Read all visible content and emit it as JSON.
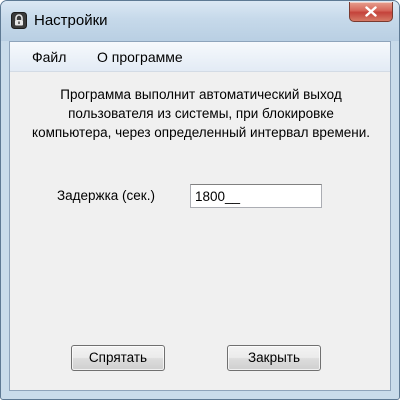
{
  "window": {
    "title": "Настройки",
    "close_label": "✕"
  },
  "menu": {
    "items": [
      {
        "label": "Файл"
      },
      {
        "label": "О программе"
      }
    ]
  },
  "main": {
    "description_lines": [
      "Программа выполнит автоматический выход",
      "пользователя из системы, при блокировке",
      "компьютера, через определенный интервал времени."
    ],
    "delay_label": "Задержка (сек.)",
    "delay_value": "1800__"
  },
  "buttons": {
    "hide_label": "Спрятать",
    "close_label": "Закрыть"
  },
  "colors": {
    "titlebar": "#c6d9ea",
    "client_bg": "#f0f0f0",
    "close_button": "#c4423a"
  },
  "icons": {
    "app": "lock-icon",
    "close": "close-icon"
  }
}
